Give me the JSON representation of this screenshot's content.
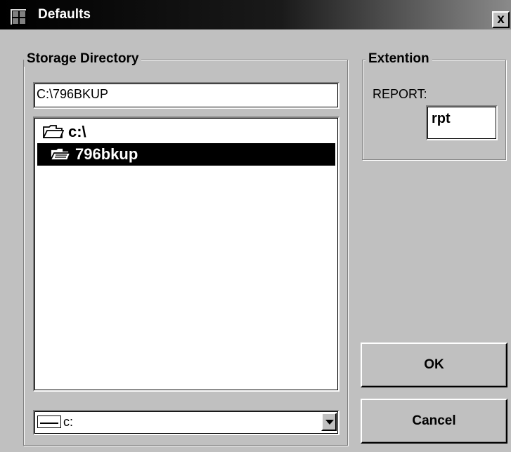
{
  "window": {
    "title": "Defaults",
    "close_label": "x"
  },
  "storage": {
    "group_label": "Storage Directory",
    "path_value": "C:\\796BKUP",
    "directories": [
      {
        "label": "c:\\",
        "icon": "open-folder-icon",
        "selected": false
      },
      {
        "label": "796bkup",
        "icon": "open-folder-icon",
        "selected": true
      }
    ],
    "drive_value": "c:"
  },
  "extension": {
    "group_label": "Extention",
    "report_label": "REPORT:",
    "report_value": "rpt"
  },
  "buttons": {
    "ok_label": "OK",
    "cancel_label": "Cancel"
  }
}
